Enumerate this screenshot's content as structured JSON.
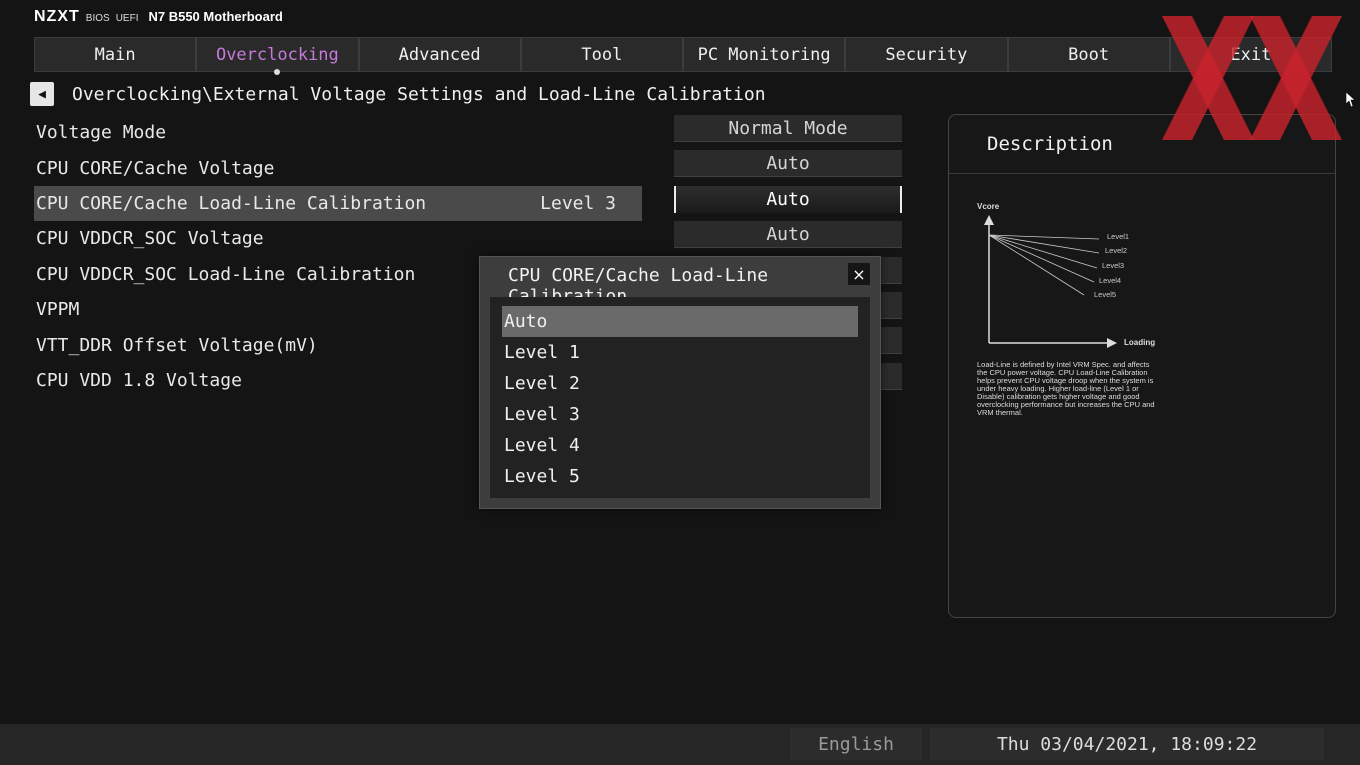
{
  "header": {
    "logo": "NZXT",
    "bios": "BIOS",
    "uefi": "UEFI",
    "model": "N7 B550 Motherboard"
  },
  "tabs": [
    {
      "label": "Main"
    },
    {
      "label": "Overclocking"
    },
    {
      "label": "Advanced"
    },
    {
      "label": "Tool"
    },
    {
      "label": "PC Monitoring"
    },
    {
      "label": "Security"
    },
    {
      "label": "Boot"
    },
    {
      "label": "Exit"
    }
  ],
  "active_tab_color": "#c77adb",
  "breadcrumb": "Overclocking\\External Voltage Settings and Load-Line Calibration",
  "settings": [
    {
      "label": "Voltage Mode",
      "value": "Normal Mode"
    },
    {
      "label": "CPU CORE/Cache Voltage",
      "value": "Auto"
    },
    {
      "label": "CPU CORE/Cache Load-Line Calibration",
      "current": "Level 3",
      "value": "Auto"
    },
    {
      "label": "CPU VDDCR_SOC Voltage",
      "value": "Auto"
    },
    {
      "label": "CPU VDDCR_SOC Load-Line Calibration"
    },
    {
      "label": "VPPM"
    },
    {
      "label": "VTT_DDR Offset Voltage(mV)"
    },
    {
      "label": "CPU VDD 1.8 Voltage"
    }
  ],
  "description": {
    "title": "Description",
    "graph": {
      "y_label": "Vcore",
      "x_label": "Loading",
      "levels": [
        "Level1",
        "Level2",
        "Level3",
        "Level4",
        "Level5"
      ]
    },
    "text": "Load-Line is defined by Intel VRM Spec. and affects the CPU power voltage. CPU Load-Line Calibration helps prevent CPU voltage droop when the system is under heavy loading. Higher load-line (Level 1 or Disable) calibration gets higher voltage and good overclocking performance but increases the CPU and VRM thermal."
  },
  "popup": {
    "title": "CPU CORE/Cache Load-Line Calibration",
    "close_icon": "×",
    "options": [
      "Auto",
      "Level 1",
      "Level 2",
      "Level 3",
      "Level 4",
      "Level 5"
    ]
  },
  "status": {
    "language": "English",
    "datetime": "Thu 03/04/2021, 18:09:22"
  }
}
